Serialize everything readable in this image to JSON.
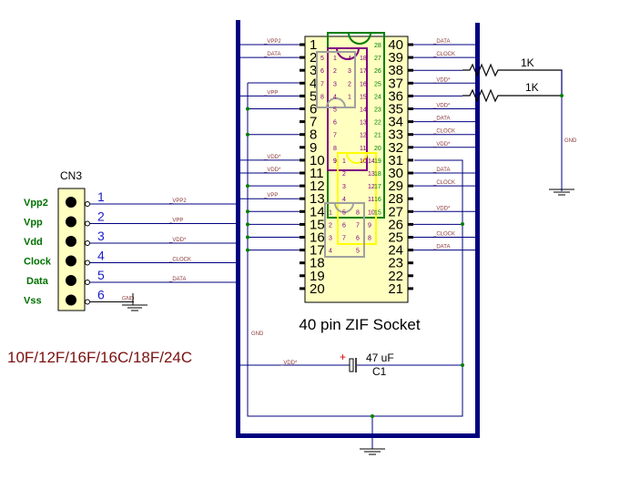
{
  "connector": {
    "ref": "CN3",
    "pins": [
      {
        "num": "1",
        "label": "Vpp2",
        "net": "_VPP2"
      },
      {
        "num": "2",
        "label": "Vpp",
        "net": "_VPP"
      },
      {
        "num": "3",
        "label": "Vdd",
        "net": "_VDD*"
      },
      {
        "num": "4",
        "label": "Clock",
        "net": "_CLOCK"
      },
      {
        "num": "5",
        "label": "Data",
        "net": "_DATA"
      },
      {
        "num": "6",
        "label": "Vss",
        "net": "GND"
      }
    ]
  },
  "socket": {
    "title": "40 pin ZIF Socket",
    "left_pins": [
      "1",
      "2",
      "3",
      "4",
      "5",
      "6",
      "7",
      "8",
      "9",
      "10",
      "11",
      "12",
      "13",
      "14",
      "15",
      "16",
      "17",
      "18",
      "19",
      "20"
    ],
    "right_pins": [
      "40",
      "39",
      "38",
      "37",
      "36",
      "35",
      "34",
      "33",
      "32",
      "31",
      "30",
      "29",
      "28",
      "27",
      "26",
      "25",
      "24",
      "23",
      "22",
      "21"
    ],
    "left_nets": {
      "1": "_VPP2",
      "2": "_DATA",
      "5": "_VPP",
      "10": "_VDD*",
      "11": "_VDD*",
      "13": "_VPP"
    },
    "right_nets": {
      "40": "_DATA",
      "39": "_CLOCK",
      "37": "_VDD*",
      "35": "_VDD*",
      "34": "_DATA",
      "33": "_CLOCK",
      "32": "_VDD*",
      "30": "_DATA",
      "29": "_CLOCK",
      "27": "_VDD*",
      "25": "_CLOCK",
      "24": "_DATA"
    }
  },
  "footprints": {
    "dip28": {
      "left": [
        "28",
        "27",
        "26",
        "25",
        "24",
        "23",
        "22",
        "21",
        "20",
        "19",
        "18",
        "17",
        "16",
        "15"
      ]
    },
    "dip18": {
      "left": [
        "1",
        "2",
        "3",
        "4",
        "5",
        "6",
        "7",
        "8",
        "9"
      ],
      "right": [
        "18",
        "17",
        "16",
        "15",
        "14",
        "13",
        "12",
        "11",
        "10"
      ]
    },
    "dip8_top": {
      "left": [
        "5",
        "6",
        "7",
        "8"
      ],
      "right": [
        "4",
        "3",
        "2",
        "1"
      ]
    },
    "dip14": {
      "left": [
        "1",
        "2",
        "3",
        "4",
        "5",
        "6",
        "7"
      ],
      "right": [
        "14",
        "13",
        "12",
        "11",
        "10",
        "9",
        "8"
      ]
    },
    "dip8_bottom": {
      "left": [
        "1",
        "2",
        "3",
        "4"
      ],
      "left2": [
        "5",
        "6",
        "7"
      ],
      "right": [
        "8",
        "7",
        "6",
        "5"
      ]
    },
    "pin9_label": "9"
  },
  "resistors": [
    {
      "value": "1K"
    },
    {
      "value": "1K"
    }
  ],
  "capacitor": {
    "ref": "C1",
    "value": "47 uF",
    "polarity": "+",
    "net": "_VDD*"
  },
  "net_labels": {
    "gnd": "GND"
  },
  "devices_label": "10F/12F/16F/16C/18F/24C",
  "colors": {
    "wire": "#000080",
    "bus": "#000080",
    "net_label": "#8b3a3a",
    "junction": "#008000",
    "socket_fill": "#ffffc0",
    "dip28": "#008000",
    "dip18": "#800080",
    "dip8": "#a0a0a0",
    "dip14": "#ffff00",
    "connector_fill": "#ffffc0",
    "connector_label": "#007000",
    "connector_pin_num": "#1c1cc8",
    "devices_label": "#7a1010"
  }
}
